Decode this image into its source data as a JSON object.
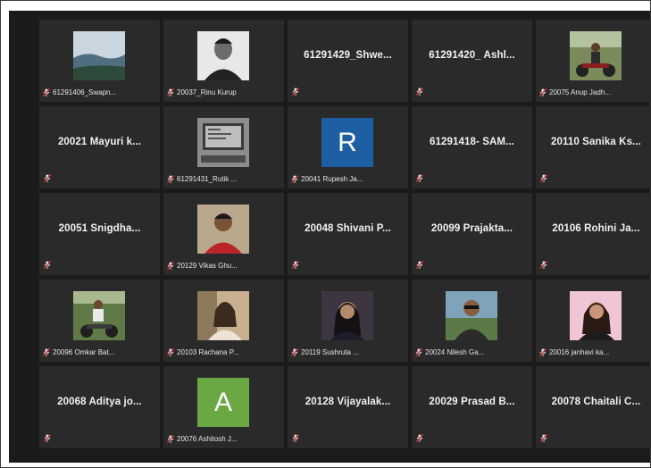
{
  "window": {
    "accent_colors": {
      "stage": "#1b1b1b",
      "tile": "#2a2a2a",
      "muted_mic": "#d33a3a"
    }
  },
  "participants": [
    {
      "display": "61291406_Swapn...",
      "mode": "video",
      "image": "landscape-sky"
    },
    {
      "display": "20037_Rinu Kurup",
      "mode": "video",
      "image": "portrait-bw"
    },
    {
      "display": "61291429_Shwe...",
      "mode": "name"
    },
    {
      "display": "61291420_ Ashl...",
      "mode": "name"
    },
    {
      "display": "20075 Anup Jadh...",
      "mode": "video",
      "image": "motorbike-outdoor"
    },
    {
      "display": "20021 Mayuri k...",
      "mode": "name"
    },
    {
      "display": "61291431_Rutik ...",
      "mode": "video",
      "image": "computer-screen"
    },
    {
      "display": "20041 Rupesh Ja...",
      "mode": "avatar",
      "letter": "R",
      "color": "#1e5fa3"
    },
    {
      "display": "61291418- SAM...",
      "mode": "name"
    },
    {
      "display": "20110 Sanika Ks...",
      "mode": "name"
    },
    {
      "display": "20051 Snigdha...",
      "mode": "name"
    },
    {
      "display": "20129 Vikas Ghu...",
      "mode": "video",
      "image": "portrait-red-shirt"
    },
    {
      "display": "20048 Shivani P...",
      "mode": "name"
    },
    {
      "display": "20099 Prajakta...",
      "mode": "name"
    },
    {
      "display": "20106 Rohini Ja...",
      "mode": "name"
    },
    {
      "display": "20096 Omkar Bat...",
      "mode": "video",
      "image": "motorbike-green"
    },
    {
      "display": "20103 Rachana P...",
      "mode": "video",
      "image": "portrait-outdoor-girl"
    },
    {
      "display": "20119 Sushruta ...",
      "mode": "video",
      "image": "selfie-dark"
    },
    {
      "display": "20024 Nilesh Ga...",
      "mode": "video",
      "image": "portrait-sunglasses"
    },
    {
      "display": "20016 janhavi ka...",
      "mode": "video",
      "image": "portrait-pink-bg"
    },
    {
      "display": "20068 Aditya jo...",
      "mode": "name"
    },
    {
      "display": "20076 Ashitosh J...",
      "mode": "avatar",
      "letter": "A",
      "color": "#6aa843"
    },
    {
      "display": "20128 Vijayalak...",
      "mode": "name"
    },
    {
      "display": "20029 Prasad B...",
      "mode": "name"
    },
    {
      "display": "20078 Chaitali C...",
      "mode": "name"
    }
  ]
}
